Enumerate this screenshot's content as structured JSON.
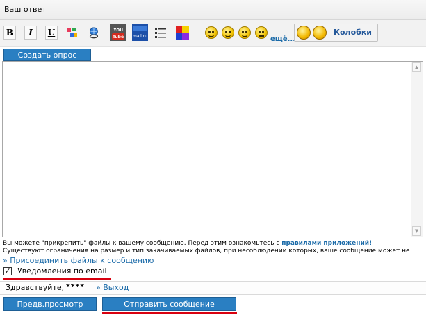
{
  "header": {
    "title": "Ваш ответ"
  },
  "toolbar": {
    "bold": "B",
    "italic": "I",
    "underline": "U",
    "youtube_label": "You Tube",
    "mailru_label": "mail.ru",
    "more_smileys": "ещё...",
    "kolobki_label": "Колобки"
  },
  "poll_button": "Создать опрос",
  "message": {
    "value": ""
  },
  "info": {
    "line1_prefix": "Вы можете \"прикрепить\" файлы к вашему сообщению. Перед этим ознакомьтесь с ",
    "line1_link": "правилами приложений!",
    "line2": "Существуют ограничения на размер и тип закачиваемых файлов, при несоблюдении которых, ваше сообщение может не"
  },
  "attach_link": "» Присоединить файлы к сообщению",
  "notify": {
    "checked": true,
    "label": "Уведомления по email"
  },
  "greeting": {
    "hello": "Здравствуйте,",
    "user": "****",
    "logout": "» Выход"
  },
  "buttons": {
    "preview": "Предв.просмотр",
    "submit": "Отправить сообщение"
  },
  "colors": {
    "accent": "#2a7fc2",
    "link": "#1a6aa8",
    "highlight": "#d8000f"
  }
}
